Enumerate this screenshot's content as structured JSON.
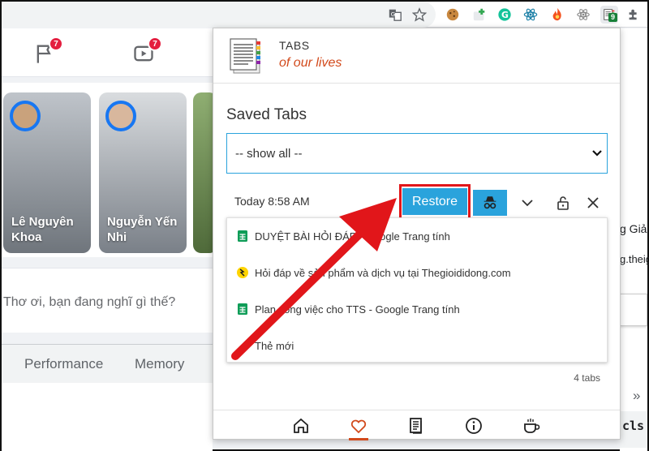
{
  "facebook": {
    "nav_badge_1": "7",
    "nav_badge_2": "7",
    "stories": [
      {
        "name": "Lê Nguyên Khoa"
      },
      {
        "name": "Nguyễn Yến Nhi"
      }
    ],
    "post_prompt": "Thơ ơi, bạn đang nghĩ gì thế?",
    "devtools_tabs": [
      "Performance",
      "Memory"
    ],
    "right_text_1": "g Giả",
    "right_text_2": "g.theig",
    "right_code": "cls",
    "right_chevron": "»"
  },
  "browser": {
    "extension_badge": "9"
  },
  "popup": {
    "brand_line1": "TABS",
    "brand_line2": "of our lives",
    "section_title": "Saved Tabs",
    "filter": {
      "selected": "-- show all --"
    },
    "session": {
      "time": "Today 8:58 AM",
      "restore_label": "Restore",
      "tabs": [
        {
          "title": "DUYỆT BÀI HỎI ĐÁP - Google Trang tính",
          "icon": "google-sheets-icon"
        },
        {
          "title": "Hỏi đáp về sản phẩm và dịch vụ tại Thegioididong.com",
          "icon": "thegioididong-icon"
        },
        {
          "title": "Plan công việc cho TTS - Google Trang tính",
          "icon": "google-sheets-icon"
        },
        {
          "title": "Thẻ mới",
          "icon": ""
        }
      ],
      "count": "4 tabs"
    },
    "colors": {
      "accent": "#2aa3dc",
      "brand": "#d24a1c",
      "highlight": "#e1161a"
    }
  }
}
